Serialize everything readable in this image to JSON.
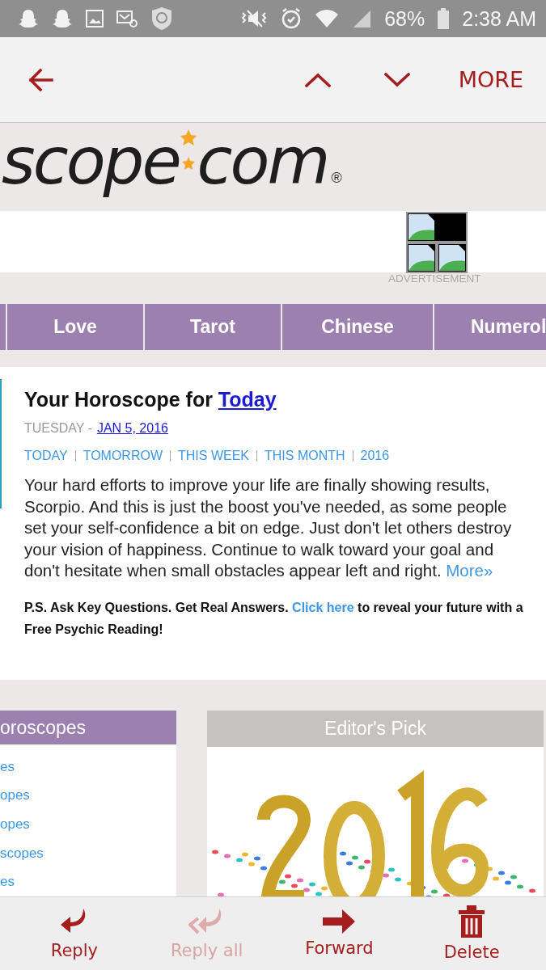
{
  "status_bar": {
    "battery": "68%",
    "time": "2:38 AM"
  },
  "toolbar": {
    "more": "MORE"
  },
  "logo": {
    "left": "scope",
    "right": "com",
    "mark": "®"
  },
  "ad": {
    "label": "ADVERTISEMENT"
  },
  "nav_tabs": [
    {
      "kind": "partial"
    },
    {
      "kind": "tab",
      "label": "Love"
    },
    {
      "kind": "tab",
      "label": "Tarot"
    },
    {
      "kind": "tab",
      "label": "Chinese"
    },
    {
      "kind": "tab",
      "label": "Numerol"
    }
  ],
  "horoscope": {
    "title": "Your Horoscope for",
    "title_link": "Today",
    "day": "TUESDAY -",
    "date": "JAN 5, 2016",
    "periods": [
      "TODAY",
      "TOMORROW",
      "THIS WEEK",
      "THIS MONTH",
      "2016"
    ],
    "text": "Your hard efforts to improve your life are finally showing results, Scorpio. And this is just the boost you've needed, as some people set your self-confidence a bit on edge. Just don't let others destroy your vision of happiness. Continue to walk toward your goal and don't hesitate when small obstacles appear left and right.",
    "more": "More»",
    "ps": "P.S. Ask Key Questions. Get Real Answers.",
    "ps_link": "Click here",
    "ps_rest": "to reveal your future with a Free Psychic Reading!"
  },
  "horoscopes_panel": {
    "title": "oroscopes",
    "items": [
      "es",
      "opes",
      "opes",
      "scopes",
      "es"
    ]
  },
  "editors_pick": {
    "title": "Editor's Pick"
  },
  "actions": [
    {
      "kind": "reply",
      "label": "Reply",
      "disabled": false
    },
    {
      "kind": "reply_all",
      "label": "Reply all",
      "disabled": true
    },
    {
      "kind": "forward",
      "label": "Forward",
      "disabled": false
    },
    {
      "kind": "delete",
      "label": "Delete",
      "disabled": false
    }
  ]
}
